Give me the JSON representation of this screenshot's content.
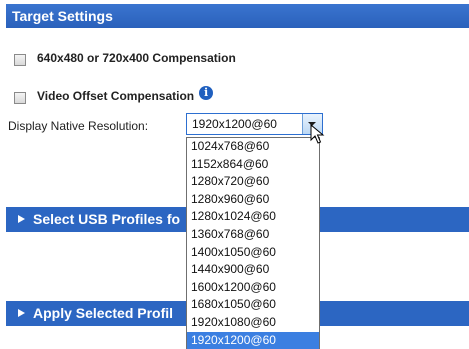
{
  "target_settings": {
    "title": "Target Settings",
    "compensation_label": "640x480 or 720x400 Compensation",
    "video_offset_label": "Video Offset Compensation",
    "info_icon": "info-icon",
    "resolution_label": "Display Native Resolution:",
    "resolution_value": "1920x1200@60"
  },
  "dropdown": {
    "options": [
      "1024x768@60",
      "1152x864@60",
      "1280x720@60",
      "1280x960@60",
      "1280x1024@60",
      "1360x768@60",
      "1400x1050@60",
      "1440x900@60",
      "1600x1200@60",
      "1680x1050@60",
      "1920x1080@60",
      "1920x1200@60"
    ],
    "selected": "1920x1200@60"
  },
  "sections": {
    "usb_profiles_label": "Select USB Profiles fo",
    "apply_profiles_label": "Apply Selected Profil"
  },
  "icons": {
    "expand": "triangle-right-icon",
    "dropdown": "chevron-down-icon",
    "cursor": "mouse-pointer-icon"
  },
  "colors": {
    "header": "#2c66c2",
    "selected_item": "#3b7fe1",
    "info_icon": "#1f5fbf"
  }
}
